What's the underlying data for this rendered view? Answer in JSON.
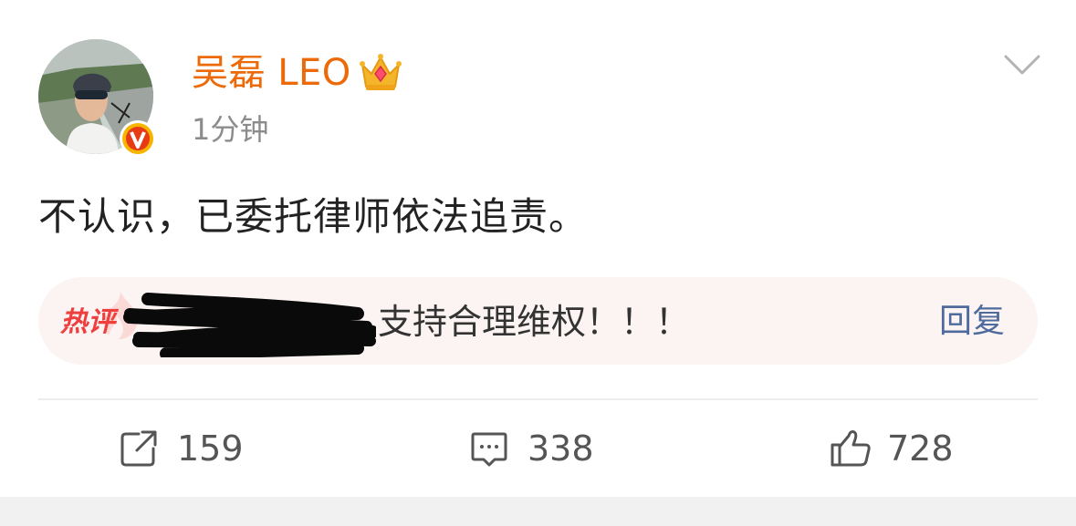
{
  "post": {
    "username": "吴磊 LEO",
    "timestamp": "1分钟",
    "text": "不认识，已委托律师依法追责。"
  },
  "hot_comment": {
    "tag": "热评",
    "text": "支持合理维权！！！",
    "reply_label": "回复"
  },
  "actions": {
    "repost_count": "159",
    "comment_count": "338",
    "like_count": "728"
  },
  "colors": {
    "username": "#ec6a08",
    "hot_tag": "#ee3f3f",
    "reply_link": "#4f6b9e",
    "hot_bg": "#fbf4f3",
    "verified_badge": "#f7b500"
  },
  "icons": {
    "crown": "crown-icon",
    "verified": "verified-v-icon",
    "menu": "chevron-down-icon",
    "repost": "share-icon",
    "comment": "comment-bubble-icon",
    "like": "thumbs-up-icon"
  }
}
